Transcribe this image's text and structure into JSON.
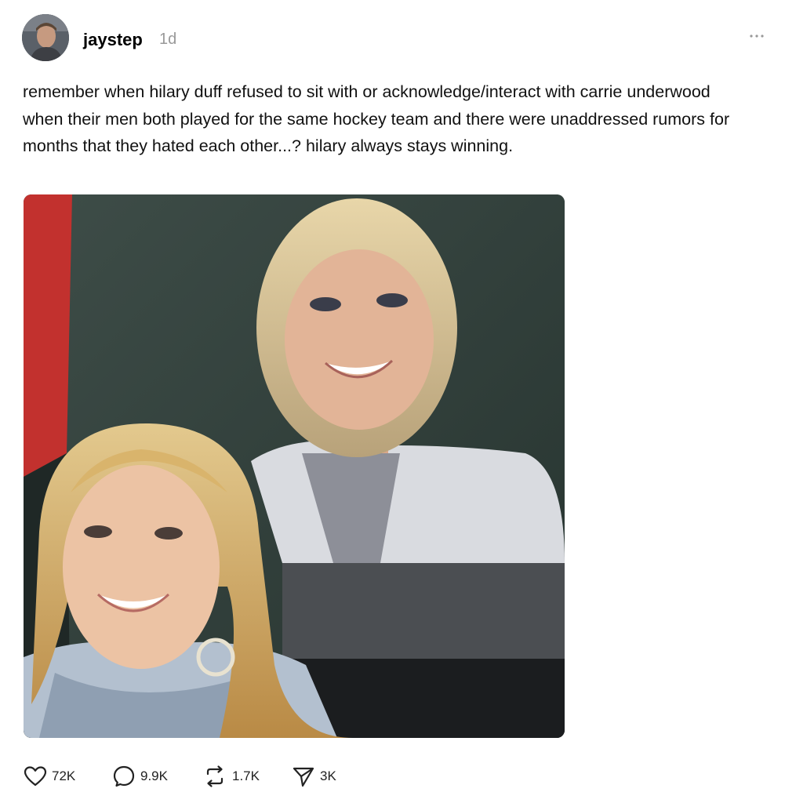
{
  "post": {
    "username": "jaystep",
    "timestamp": "1d",
    "caption": "remember when hilary duff refused to sit with or acknowledge/interact with carrie underwood when their men both played for the same hockey team and there were unaddressed rumors for months that they hated each other...? hilary always stays winning."
  },
  "header": {
    "avatar_icon": "avatar-photo",
    "more_icon": "ellipsis-icon"
  },
  "image": {
    "description_icon": "photo-two-women-at-hockey-game"
  },
  "actions": {
    "likes": "72K",
    "comments": "9.9K",
    "reposts": "1.7K",
    "shares": "3K"
  },
  "colors": {
    "text": "#111111",
    "muted": "#999999",
    "icon": "#222222"
  }
}
